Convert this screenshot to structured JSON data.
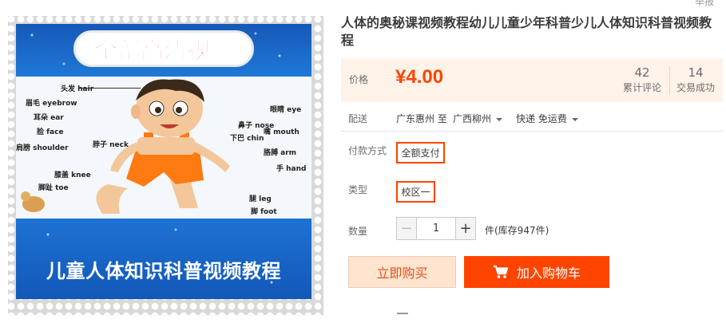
{
  "report_link": "举报",
  "product": {
    "title": "人体的奥秘课视频教程幼儿儿童少年科普少儿人体知识科普视频教程"
  },
  "image": {
    "banner_text": "全部高清视频",
    "caption": "儿童人体知识科普视频教程",
    "body_labels": [
      {
        "text": "头发 hair"
      },
      {
        "text": "眉毛 eyebrow"
      },
      {
        "text": "耳朵 ear"
      },
      {
        "text": "脸 face"
      },
      {
        "text": "脖子 neck"
      },
      {
        "text": "肩膀 shoulder"
      },
      {
        "text": "膝盖 knee"
      },
      {
        "text": "脚趾 toe"
      },
      {
        "text": "眼睛 eye"
      },
      {
        "text": "鼻子 nose"
      },
      {
        "text": "嘴 mouth"
      },
      {
        "text": "下巴 chin"
      },
      {
        "text": "胳膊 arm"
      },
      {
        "text": "手 hand"
      },
      {
        "text": "腿 leg"
      },
      {
        "text": "脚 foot"
      }
    ]
  },
  "price": {
    "label": "价格",
    "value": "¥4.00",
    "reviews_count": "42",
    "reviews_label": "累计评论",
    "deals_count": "14",
    "deals_label": "交易成功"
  },
  "shipping": {
    "label": "配送",
    "from": "广东惠州 至",
    "to": "广西柳州",
    "method": "快递 免运费"
  },
  "payment": {
    "label": "付款方式",
    "option": "全额支付"
  },
  "type": {
    "label": "类型",
    "option": "校区一"
  },
  "quantity": {
    "label": "数量",
    "value": "1",
    "minus": "−",
    "plus": "+",
    "stock": "件(库存947件)"
  },
  "actions": {
    "buy_now": "立即购买",
    "add_to_cart": "加入购物车"
  },
  "colors": {
    "accent": "#ff4400",
    "price_bg": "#fff2e8",
    "poster_blue": "#1a68c8"
  }
}
